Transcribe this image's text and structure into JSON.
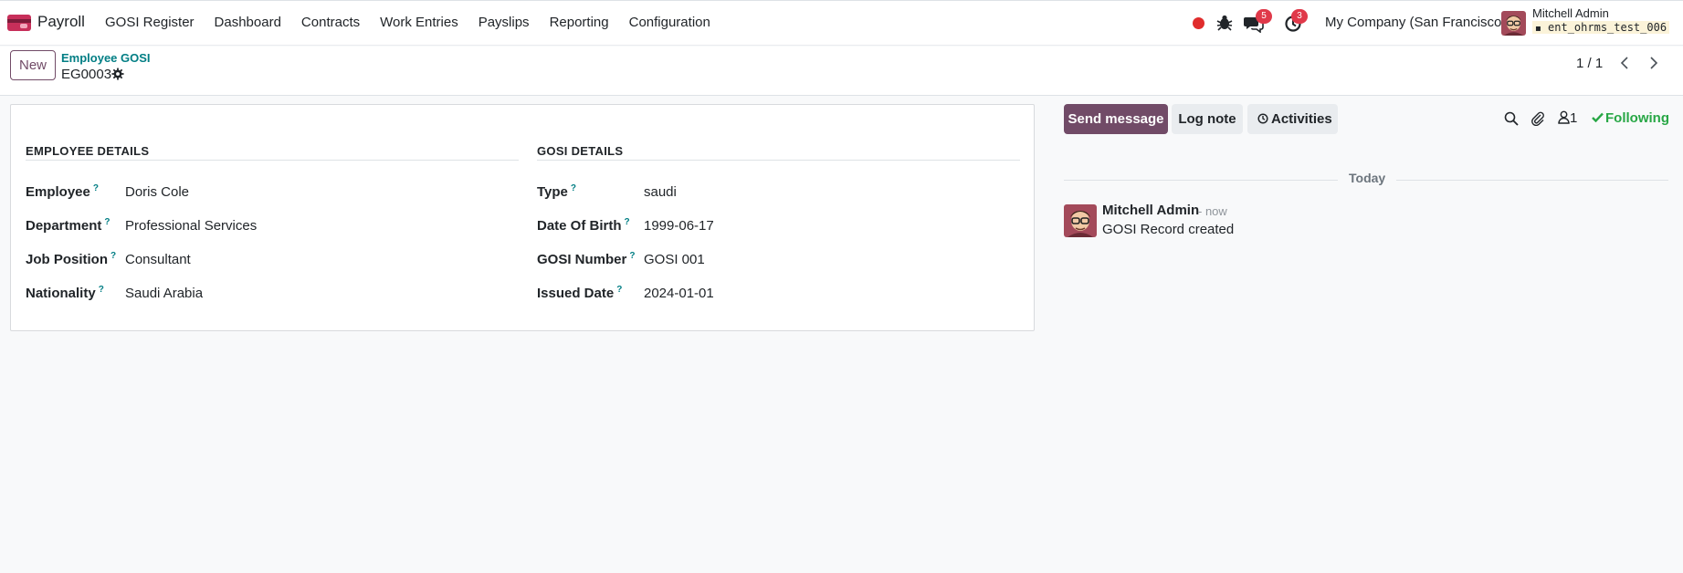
{
  "navbar": {
    "app_name": "Payroll",
    "menu": [
      "GOSI Register",
      "Dashboard",
      "Contracts",
      "Work Entries",
      "Payslips",
      "Reporting",
      "Configuration"
    ],
    "chat_badge": "5",
    "activity_badge": "3",
    "company": "My Company (San Francisco)",
    "user_name": "Mitchell Admin",
    "db_name": "ent_ohrms_test_006"
  },
  "control_panel": {
    "new_label": "New",
    "breadcrumb": "Employee GOSI",
    "record": "EG0003",
    "pager": "1 / 1"
  },
  "form": {
    "employee_group": {
      "title": "EMPLOYEE DETAILS",
      "fields": [
        {
          "label": "Employee",
          "value": "Doris Cole"
        },
        {
          "label": "Department",
          "value": "Professional Services"
        },
        {
          "label": "Job Position",
          "value": "Consultant"
        },
        {
          "label": "Nationality",
          "value": "Saudi Arabia"
        }
      ]
    },
    "gosi_group": {
      "title": "GOSI DETAILS",
      "fields": [
        {
          "label": "Type",
          "value": "saudi"
        },
        {
          "label": "Date Of Birth",
          "value": "1999-06-17"
        },
        {
          "label": "GOSI Number",
          "value": "GOSI 001"
        },
        {
          "label": "Issued Date",
          "value": "2024-01-01"
        }
      ]
    },
    "help_mark": "?"
  },
  "chatter": {
    "send_message": "Send message",
    "log_note": "Log note",
    "activities": "Activities",
    "followers_count": "1",
    "following": "Following",
    "today": "Today",
    "message": {
      "author": "Mitchell Admin",
      "time": "- now",
      "body": "GOSI Record created"
    }
  },
  "colors": {
    "brand": "#714b67",
    "link": "#017e84",
    "following": "#28a745",
    "badge": "#e0394a"
  }
}
